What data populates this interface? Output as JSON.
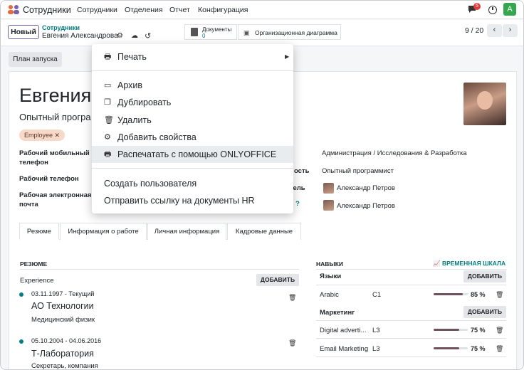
{
  "app": {
    "brand": "Сотрудники",
    "menu": [
      "Сотрудники",
      "Отделения",
      "Отчет",
      "Конфигурация"
    ],
    "chat_count": "5",
    "user_initial": "A"
  },
  "control": {
    "new_label": "Новый",
    "breadcrumb_parent": "Сотрудники",
    "breadcrumb_current": "Евгения Александрова",
    "docs_label": "Документы",
    "docs_count": "0",
    "org_chart_label": "Организационная диаграмма",
    "pager": "9 / 20"
  },
  "actions": {
    "launch_plan": "План запуска"
  },
  "employee": {
    "name": "Евгения",
    "job_title": "Опытный програ",
    "tag": "Employee ✕",
    "fields_left": [
      {
        "label": "Рабочий мобильный телефон"
      },
      {
        "label": "Рабочий телефон"
      },
      {
        "label": "Рабочая электронная почта"
      }
    ],
    "fields_right": [
      {
        "label": "",
        "value": "Администрация / Исследования & Разработка"
      },
      {
        "label": "ость",
        "value": "Опытный программист"
      },
      {
        "label": "итель",
        "value": "Александр Петров"
      },
      {
        "label": "?",
        "value": "Александр Петров"
      }
    ]
  },
  "tabs": [
    "Резюме",
    "Информация о работе",
    "Личная информация",
    "Кадровые данные"
  ],
  "resume": {
    "title": "РЕЗЮМЕ",
    "group": "Experience",
    "add": "ДОБАВИТЬ",
    "entries": [
      {
        "dates": "03.11.1997 - Текущий",
        "org": "АО Технологии",
        "role": "Медицинский физик"
      },
      {
        "dates": "05.10.2004 - 04.06.2016",
        "org": "Т-Лаборатория",
        "role": "Секретарь, компания"
      }
    ]
  },
  "skills": {
    "title": "НАВЫКИ",
    "timeline": "ВРЕМЕННАЯ ШКАЛА",
    "add": "ДОБАВИТЬ",
    "groups": [
      {
        "name": "Языки",
        "items": [
          {
            "skill": "Arabic",
            "level": "C1",
            "progress": 85,
            "pct": "85 %"
          }
        ]
      },
      {
        "name": "Маркетинг",
        "items": [
          {
            "skill": "Digital adverti...",
            "level": "L3",
            "progress": 75,
            "pct": "75 %"
          },
          {
            "skill": "Email Marketing",
            "level": "L3",
            "progress": 75,
            "pct": "75 %"
          }
        ]
      }
    ]
  },
  "dropdown": {
    "print": "Печать",
    "archive": "Архив",
    "duplicate": "Дублировать",
    "delete": "Удалить",
    "add_props": "Добавить свойства",
    "print_onlyoffice": "Распечатать с помощью ONLYOFFICE",
    "create_user": "Создать пользователя",
    "send_hr_link": "Отправить ссылку на документы HR"
  }
}
